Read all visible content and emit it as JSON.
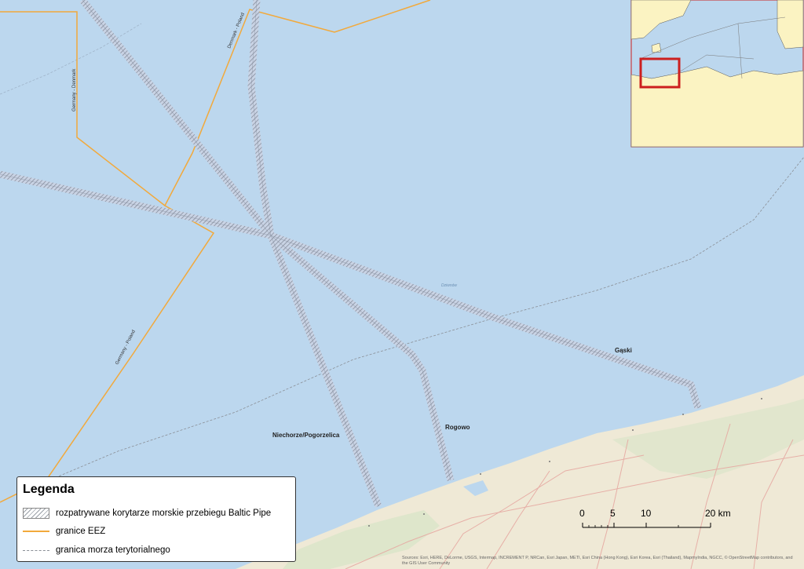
{
  "map": {
    "crossing_label": "Gąski",
    "landing_labels": [
      "Rogowo",
      "Niechorze/Pogorzelica"
    ],
    "boundary_labels": [
      "Denmark - Poland",
      "Germany - Denmark",
      "Germany - Poland"
    ],
    "water_label": "Dziwnów"
  },
  "legend": {
    "title": "Legenda",
    "items": [
      {
        "label": "rozpatrywane korytarze morskie przebiegu Baltic Pipe",
        "symbol": "hatched-corridor"
      },
      {
        "label": "granice EEZ",
        "symbol": "orange-line"
      },
      {
        "label": "granica morza terytorialnego",
        "symbol": "gray-dashed-line"
      }
    ]
  },
  "scalebar": {
    "ticks": [
      "0",
      "5",
      "10",
      "20 km"
    ]
  },
  "attribution": "Sources: Esri, HERE, DeLorme, USGS, Intermap, INCREMENT P, NRCan, Esri Japan, METI, Esri China (Hong Kong), Esri Korea, Esri (Thailand), MapmyIndia, NGCC, © OpenStreetMap contributors, and the GIS User Community",
  "colors": {
    "sea": "#bcd7ee",
    "land": "#efe9d6",
    "eez": "#f2a93b",
    "corridor": "#8f9aae",
    "inset_frame": "#cc1f1f"
  }
}
